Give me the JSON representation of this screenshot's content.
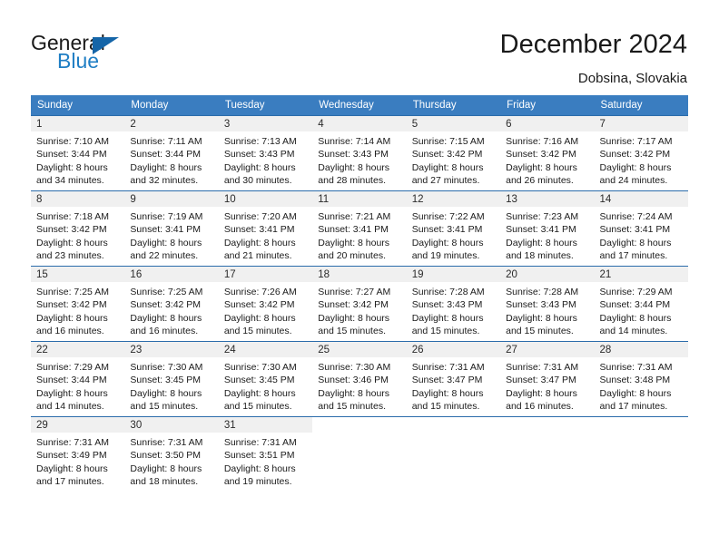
{
  "brand": {
    "name_part1": "General",
    "name_part2": "Blue",
    "logo_icon": "triangle-logo-icon",
    "accent_color": "#1f7ec4",
    "dark_color": "#1565a8"
  },
  "header": {
    "title": "December 2024",
    "location": "Dobsina, Slovakia"
  },
  "calendar": {
    "header_bg": "#3a7dc0",
    "daynum_bg": "#f0f0f0",
    "separator_color": "#2b6cab",
    "weekdays": [
      "Sunday",
      "Monday",
      "Tuesday",
      "Wednesday",
      "Thursday",
      "Friday",
      "Saturday"
    ],
    "weeks": [
      [
        {
          "day": "1",
          "line1": "Sunrise: 7:10 AM",
          "line2": "Sunset: 3:44 PM",
          "line3": "Daylight: 8 hours",
          "line4": "and 34 minutes."
        },
        {
          "day": "2",
          "line1": "Sunrise: 7:11 AM",
          "line2": "Sunset: 3:44 PM",
          "line3": "Daylight: 8 hours",
          "line4": "and 32 minutes."
        },
        {
          "day": "3",
          "line1": "Sunrise: 7:13 AM",
          "line2": "Sunset: 3:43 PM",
          "line3": "Daylight: 8 hours",
          "line4": "and 30 minutes."
        },
        {
          "day": "4",
          "line1": "Sunrise: 7:14 AM",
          "line2": "Sunset: 3:43 PM",
          "line3": "Daylight: 8 hours",
          "line4": "and 28 minutes."
        },
        {
          "day": "5",
          "line1": "Sunrise: 7:15 AM",
          "line2": "Sunset: 3:42 PM",
          "line3": "Daylight: 8 hours",
          "line4": "and 27 minutes."
        },
        {
          "day": "6",
          "line1": "Sunrise: 7:16 AM",
          "line2": "Sunset: 3:42 PM",
          "line3": "Daylight: 8 hours",
          "line4": "and 26 minutes."
        },
        {
          "day": "7",
          "line1": "Sunrise: 7:17 AM",
          "line2": "Sunset: 3:42 PM",
          "line3": "Daylight: 8 hours",
          "line4": "and 24 minutes."
        }
      ],
      [
        {
          "day": "8",
          "line1": "Sunrise: 7:18 AM",
          "line2": "Sunset: 3:42 PM",
          "line3": "Daylight: 8 hours",
          "line4": "and 23 minutes."
        },
        {
          "day": "9",
          "line1": "Sunrise: 7:19 AM",
          "line2": "Sunset: 3:41 PM",
          "line3": "Daylight: 8 hours",
          "line4": "and 22 minutes."
        },
        {
          "day": "10",
          "line1": "Sunrise: 7:20 AM",
          "line2": "Sunset: 3:41 PM",
          "line3": "Daylight: 8 hours",
          "line4": "and 21 minutes."
        },
        {
          "day": "11",
          "line1": "Sunrise: 7:21 AM",
          "line2": "Sunset: 3:41 PM",
          "line3": "Daylight: 8 hours",
          "line4": "and 20 minutes."
        },
        {
          "day": "12",
          "line1": "Sunrise: 7:22 AM",
          "line2": "Sunset: 3:41 PM",
          "line3": "Daylight: 8 hours",
          "line4": "and 19 minutes."
        },
        {
          "day": "13",
          "line1": "Sunrise: 7:23 AM",
          "line2": "Sunset: 3:41 PM",
          "line3": "Daylight: 8 hours",
          "line4": "and 18 minutes."
        },
        {
          "day": "14",
          "line1": "Sunrise: 7:24 AM",
          "line2": "Sunset: 3:41 PM",
          "line3": "Daylight: 8 hours",
          "line4": "and 17 minutes."
        }
      ],
      [
        {
          "day": "15",
          "line1": "Sunrise: 7:25 AM",
          "line2": "Sunset: 3:42 PM",
          "line3": "Daylight: 8 hours",
          "line4": "and 16 minutes."
        },
        {
          "day": "16",
          "line1": "Sunrise: 7:25 AM",
          "line2": "Sunset: 3:42 PM",
          "line3": "Daylight: 8 hours",
          "line4": "and 16 minutes."
        },
        {
          "day": "17",
          "line1": "Sunrise: 7:26 AM",
          "line2": "Sunset: 3:42 PM",
          "line3": "Daylight: 8 hours",
          "line4": "and 15 minutes."
        },
        {
          "day": "18",
          "line1": "Sunrise: 7:27 AM",
          "line2": "Sunset: 3:42 PM",
          "line3": "Daylight: 8 hours",
          "line4": "and 15 minutes."
        },
        {
          "day": "19",
          "line1": "Sunrise: 7:28 AM",
          "line2": "Sunset: 3:43 PM",
          "line3": "Daylight: 8 hours",
          "line4": "and 15 minutes."
        },
        {
          "day": "20",
          "line1": "Sunrise: 7:28 AM",
          "line2": "Sunset: 3:43 PM",
          "line3": "Daylight: 8 hours",
          "line4": "and 15 minutes."
        },
        {
          "day": "21",
          "line1": "Sunrise: 7:29 AM",
          "line2": "Sunset: 3:44 PM",
          "line3": "Daylight: 8 hours",
          "line4": "and 14 minutes."
        }
      ],
      [
        {
          "day": "22",
          "line1": "Sunrise: 7:29 AM",
          "line2": "Sunset: 3:44 PM",
          "line3": "Daylight: 8 hours",
          "line4": "and 14 minutes."
        },
        {
          "day": "23",
          "line1": "Sunrise: 7:30 AM",
          "line2": "Sunset: 3:45 PM",
          "line3": "Daylight: 8 hours",
          "line4": "and 15 minutes."
        },
        {
          "day": "24",
          "line1": "Sunrise: 7:30 AM",
          "line2": "Sunset: 3:45 PM",
          "line3": "Daylight: 8 hours",
          "line4": "and 15 minutes."
        },
        {
          "day": "25",
          "line1": "Sunrise: 7:30 AM",
          "line2": "Sunset: 3:46 PM",
          "line3": "Daylight: 8 hours",
          "line4": "and 15 minutes."
        },
        {
          "day": "26",
          "line1": "Sunrise: 7:31 AM",
          "line2": "Sunset: 3:47 PM",
          "line3": "Daylight: 8 hours",
          "line4": "and 15 minutes."
        },
        {
          "day": "27",
          "line1": "Sunrise: 7:31 AM",
          "line2": "Sunset: 3:47 PM",
          "line3": "Daylight: 8 hours",
          "line4": "and 16 minutes."
        },
        {
          "day": "28",
          "line1": "Sunrise: 7:31 AM",
          "line2": "Sunset: 3:48 PM",
          "line3": "Daylight: 8 hours",
          "line4": "and 17 minutes."
        }
      ],
      [
        {
          "day": "29",
          "line1": "Sunrise: 7:31 AM",
          "line2": "Sunset: 3:49 PM",
          "line3": "Daylight: 8 hours",
          "line4": "and 17 minutes."
        },
        {
          "day": "30",
          "line1": "Sunrise: 7:31 AM",
          "line2": "Sunset: 3:50 PM",
          "line3": "Daylight: 8 hours",
          "line4": "and 18 minutes."
        },
        {
          "day": "31",
          "line1": "Sunrise: 7:31 AM",
          "line2": "Sunset: 3:51 PM",
          "line3": "Daylight: 8 hours",
          "line4": "and 19 minutes."
        },
        {
          "day": "",
          "line1": "",
          "line2": "",
          "line3": "",
          "line4": ""
        },
        {
          "day": "",
          "line1": "",
          "line2": "",
          "line3": "",
          "line4": ""
        },
        {
          "day": "",
          "line1": "",
          "line2": "",
          "line3": "",
          "line4": ""
        },
        {
          "day": "",
          "line1": "",
          "line2": "",
          "line3": "",
          "line4": ""
        }
      ]
    ]
  }
}
